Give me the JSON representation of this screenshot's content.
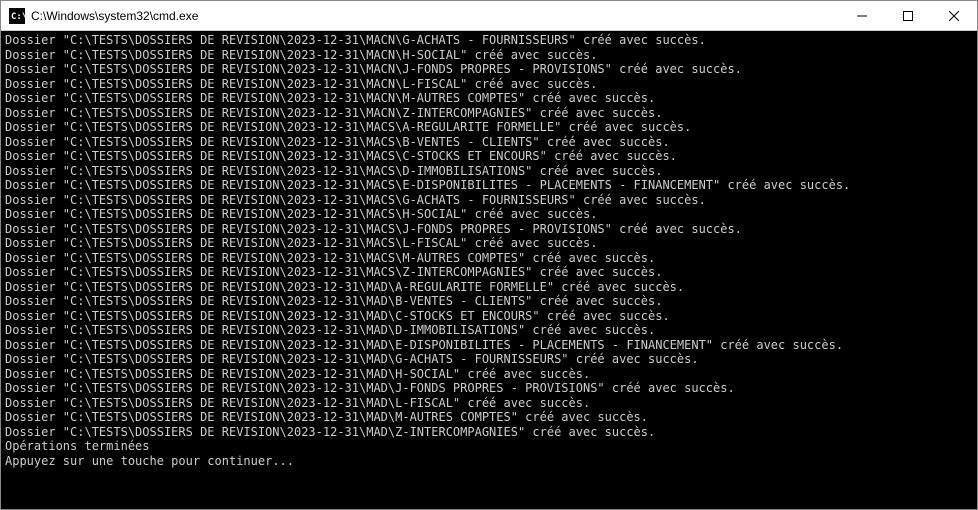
{
  "title": "C:\\Windows\\system32\\cmd.exe",
  "icon_name": "cmd-icon",
  "lines": [
    "Dossier \"C:\\TESTS\\DOSSIERS DE REVISION\\2023-12-31\\MACN\\G-ACHATS - FOURNISSEURS\" créé avec succès.",
    "Dossier \"C:\\TESTS\\DOSSIERS DE REVISION\\2023-12-31\\MACN\\H-SOCIAL\" créé avec succès.",
    "Dossier \"C:\\TESTS\\DOSSIERS DE REVISION\\2023-12-31\\MACN\\J-FONDS PROPRES - PROVISIONS\" créé avec succès.",
    "Dossier \"C:\\TESTS\\DOSSIERS DE REVISION\\2023-12-31\\MACN\\L-FISCAL\" créé avec succès.",
    "Dossier \"C:\\TESTS\\DOSSIERS DE REVISION\\2023-12-31\\MACN\\M-AUTRES COMPTES\" créé avec succès.",
    "Dossier \"C:\\TESTS\\DOSSIERS DE REVISION\\2023-12-31\\MACN\\Z-INTERCOMPAGNIES\" créé avec succès.",
    "Dossier \"C:\\TESTS\\DOSSIERS DE REVISION\\2023-12-31\\MACS\\A-REGULARITE FORMELLE\" créé avec succès.",
    "Dossier \"C:\\TESTS\\DOSSIERS DE REVISION\\2023-12-31\\MACS\\B-VENTES - CLIENTS\" créé avec succès.",
    "Dossier \"C:\\TESTS\\DOSSIERS DE REVISION\\2023-12-31\\MACS\\C-STOCKS ET ENCOURS\" créé avec succès.",
    "Dossier \"C:\\TESTS\\DOSSIERS DE REVISION\\2023-12-31\\MACS\\D-IMMOBILISATIONS\" créé avec succès.",
    "Dossier \"C:\\TESTS\\DOSSIERS DE REVISION\\2023-12-31\\MACS\\E-DISPONIBILITES - PLACEMENTS - FINANCEMENT\" créé avec succès.",
    "Dossier \"C:\\TESTS\\DOSSIERS DE REVISION\\2023-12-31\\MACS\\G-ACHATS - FOURNISSEURS\" créé avec succès.",
    "Dossier \"C:\\TESTS\\DOSSIERS DE REVISION\\2023-12-31\\MACS\\H-SOCIAL\" créé avec succès.",
    "Dossier \"C:\\TESTS\\DOSSIERS DE REVISION\\2023-12-31\\MACS\\J-FONDS PROPRES - PROVISIONS\" créé avec succès.",
    "Dossier \"C:\\TESTS\\DOSSIERS DE REVISION\\2023-12-31\\MACS\\L-FISCAL\" créé avec succès.",
    "Dossier \"C:\\TESTS\\DOSSIERS DE REVISION\\2023-12-31\\MACS\\M-AUTRES COMPTES\" créé avec succès.",
    "Dossier \"C:\\TESTS\\DOSSIERS DE REVISION\\2023-12-31\\MACS\\Z-INTERCOMPAGNIES\" créé avec succès.",
    "Dossier \"C:\\TESTS\\DOSSIERS DE REVISION\\2023-12-31\\MAD\\A-REGULARITE FORMELLE\" créé avec succès.",
    "Dossier \"C:\\TESTS\\DOSSIERS DE REVISION\\2023-12-31\\MAD\\B-VENTES - CLIENTS\" créé avec succès.",
    "Dossier \"C:\\TESTS\\DOSSIERS DE REVISION\\2023-12-31\\MAD\\C-STOCKS ET ENCOURS\" créé avec succès.",
    "Dossier \"C:\\TESTS\\DOSSIERS DE REVISION\\2023-12-31\\MAD\\D-IMMOBILISATIONS\" créé avec succès.",
    "Dossier \"C:\\TESTS\\DOSSIERS DE REVISION\\2023-12-31\\MAD\\E-DISPONIBILITES - PLACEMENTS - FINANCEMENT\" créé avec succès.",
    "Dossier \"C:\\TESTS\\DOSSIERS DE REVISION\\2023-12-31\\MAD\\G-ACHATS - FOURNISSEURS\" créé avec succès.",
    "Dossier \"C:\\TESTS\\DOSSIERS DE REVISION\\2023-12-31\\MAD\\H-SOCIAL\" créé avec succès.",
    "Dossier \"C:\\TESTS\\DOSSIERS DE REVISION\\2023-12-31\\MAD\\J-FONDS PROPRES - PROVISIONS\" créé avec succès.",
    "Dossier \"C:\\TESTS\\DOSSIERS DE REVISION\\2023-12-31\\MAD\\L-FISCAL\" créé avec succès.",
    "Dossier \"C:\\TESTS\\DOSSIERS DE REVISION\\2023-12-31\\MAD\\M-AUTRES COMPTES\" créé avec succès.",
    "Dossier \"C:\\TESTS\\DOSSIERS DE REVISION\\2023-12-31\\MAD\\Z-INTERCOMPAGNIES\" créé avec succès.",
    "Opérations terminées",
    "Appuyez sur une touche pour continuer..."
  ]
}
